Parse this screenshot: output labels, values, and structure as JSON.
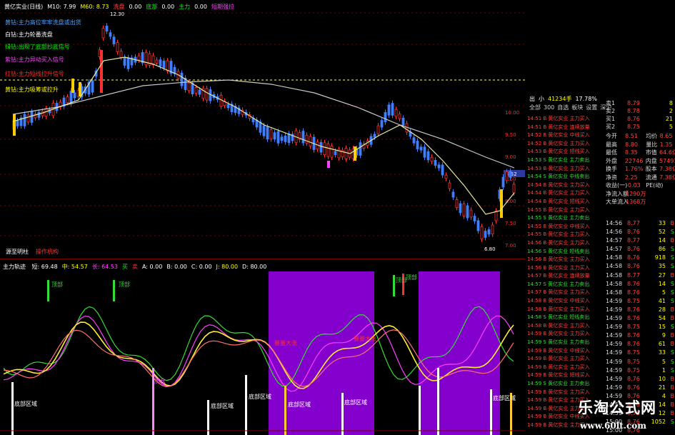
{
  "main": {
    "top_items": [
      {
        "text": "黄亿实业(日线)",
        "color": "#ffffff"
      },
      {
        "text": "M10: 7.99",
        "color": "#ffffff"
      },
      {
        "text": "M60: 8.73",
        "color": "#ffff00"
      },
      {
        "text": "洗盘",
        "color": "#ff4040"
      },
      {
        "text": "0.00",
        "color": "#ffffff"
      },
      {
        "text": "底部",
        "color": "#00ff00"
      },
      {
        "text": "0.00",
        "color": "#ffffff"
      },
      {
        "text": "主力",
        "color": "#00ff00"
      },
      {
        "text": "0.00",
        "color": "#ffffff"
      },
      {
        "text": "短期强拉",
        "color": "#ff40ff"
      }
    ],
    "legend_lines": [
      {
        "text": "黄钻:主力高位牢牢洗盘或出货",
        "color": "#4fa3ff"
      },
      {
        "text": "白钻:主力轮番洗盘",
        "color": "#ffffff"
      },
      {
        "text": "绿钻:出现了底部抄底信号",
        "color": "#00ff00"
      },
      {
        "text": "紫钻:主力异动买入信号",
        "color": "#ff40ff"
      },
      {
        "text": "红钻:主力短线拉升信号",
        "color": "#ff3030"
      },
      {
        "text": "黄钻:主力吸筹或拉升",
        "color": "#ffff00"
      }
    ],
    "high_label": "12.30",
    "low_label": "6.80",
    "bottom_labels": [
      {
        "text": "源至明柱",
        "color": "#ffffff"
      },
      {
        "text": "操作机构",
        "color": "#ff3030"
      }
    ],
    "price_ticks": [
      "10.00",
      "9.50",
      "9.00",
      "8.50",
      "8.00",
      "7.50",
      "7.00"
    ],
    "current_price": "8.52"
  },
  "sub": {
    "title": "主力轨迹",
    "items": [
      {
        "text": "短: 69.48",
        "color": "#ffffff"
      },
      {
        "text": "中: 54.57",
        "color": "#ffff00"
      },
      {
        "text": "长: 64.53",
        "color": "#ff40ff"
      },
      {
        "text": "买",
        "color": "#00ff00"
      },
      {
        "text": "卖",
        "color": "#ff3030"
      },
      {
        "text": "A: 0.00",
        "color": "#ffffff"
      },
      {
        "text": "B: 0.00",
        "color": "#ffffff"
      },
      {
        "text": "C: 0.00",
        "color": "#ffffff"
      },
      {
        "text": "J: 80.00",
        "color": "#ffff00"
      },
      {
        "text": "D: 80.00",
        "color": "#ffffff"
      }
    ],
    "zone_labels": [
      "顶部",
      "顶部",
      "顶部",
      "顶部"
    ],
    "bottom_label": "底部区域",
    "signal_labels": [
      "加仓",
      "暴量大涨",
      "暴量大涨"
    ]
  },
  "right_panel": {
    "header": [
      {
        "text": "出",
        "color": "#ffffff"
      },
      {
        "text": "小",
        "color": "#ffffff"
      },
      {
        "text": "41234手",
        "color": "#ffff00"
      },
      {
        "text": "17.78%",
        "color": "#ffffff"
      }
    ],
    "tabs": [
      "全部",
      "300",
      "自选",
      "板块",
      "设置",
      "深沪"
    ],
    "stock_list": [
      "14:51 B  黄亿实业  主力买入",
      "14:51 B  黄亿实业  连续放量",
      "14:52 B  黄亿实业  中线买入",
      "14:52 B  黄亿实业  主力买入",
      "14:53 B  黄亿实业  短线买入",
      "14:53 S  黄亿实业  主力卖出",
      "14:53 B  黄亿实业  主力买入",
      "14:54 S  黄亿实业  中线卖出",
      "14:54 B  黄亿实业  主力买入",
      "14:54 B  黄亿实业  主力买入",
      "14:54 B  黄亿实业  短线买入",
      "14:55 B  黄亿实业  主力买入",
      "14:55 S  黄亿实业  主力卖出",
      "14:55 B  黄亿实业  中线买入",
      "14:55 B  黄亿实业  主力买入",
      "14:56 B  黄亿实业  主力买入",
      "14:56 S  黄亿实业  短线卖出",
      "14:56 B  黄亿实业  主力买入",
      "14:56 B  黄亿实业  主力买入",
      "14:57 B  黄亿实业  连续放量",
      "14:57 S  黄亿实业  主力卖出",
      "14:57 B  黄亿实业  主力买入",
      "14:58 B  黄亿实业  中线买入",
      "14:58 B  黄亿实业  主力买入",
      "14:58 S  黄亿实业  短线卖出",
      "14:58 B  黄亿实业  主力买入",
      "14:59 B  黄亿实业  主力买入",
      "14:59 S  黄亿实业  主力卖出",
      "14:59 B  黄亿实业  中线买入",
      "14:59 B  黄亿实业  主力买入",
      "14:59 B  黄亿实业  主力买入",
      "14:59 B  黄亿实业  短线买入",
      "14:59 S  黄亿实业  主力卖出",
      "14:59 B  黄亿实业  主力买入",
      "14:59 B  黄亿实业  主力买入",
      "14:59 B  黄亿实业  主力买入",
      "14:59 B  黄亿实业  中线买入",
      "14:59 B  黄亿实业  主力买入"
    ],
    "order_rows": [
      {
        "label": "卖1",
        "price": "8.79",
        "vol": "8"
      },
      {
        "label": "卖2",
        "price": "8.78",
        "vol": "2"
      },
      {
        "label": "买1",
        "price": "8.76",
        "vol": "21"
      },
      {
        "label": "买2",
        "price": "8.75",
        "vol": "5"
      }
    ],
    "stats": [
      {
        "k": "今开",
        "v": "8.51",
        "k2": "均价",
        "v2": "8.65"
      },
      {
        "k": "最高",
        "v": "8.80",
        "k2": "量比",
        "v2": "1.35"
      },
      {
        "k": "最低",
        "v": "8.35",
        "k2": "市值",
        "v2": "64.6亿"
      },
      {
        "k": "外盘",
        "v": "22746",
        "k2": "内盘",
        "v2": "57491"
      },
      {
        "k": "换手",
        "v": "1.76%",
        "k2": "股本",
        "v2": "7.38亿"
      },
      {
        "k": "净资",
        "v": "2.25",
        "k2": "流通",
        "v2": "7.38亿"
      },
      {
        "k": "收益(一)",
        "v": "-0.03",
        "k2": "PE(动)",
        "v2": ""
      },
      {
        "k": "净流入额",
        "v": "1290万",
        "k2": "",
        "v2": ""
      },
      {
        "k": "大单流入",
        "v": "1368万",
        "k2": "",
        "v2": ""
      }
    ],
    "trades": [
      {
        "t": "14:56",
        "p": "8.77",
        "v": "33",
        "d": "B"
      },
      {
        "t": "14:56",
        "p": "8.76",
        "v": "52",
        "d": "S"
      },
      {
        "t": "14:57",
        "p": "8.77",
        "v": "14",
        "d": "B"
      },
      {
        "t": "14:57",
        "p": "8.76",
        "v": "86",
        "d": "S"
      },
      {
        "t": "14:58",
        "p": "8.76",
        "v": "918",
        "d": "S"
      },
      {
        "t": "14:58",
        "p": "8.76",
        "v": "35",
        "d": "S"
      },
      {
        "t": "14:58",
        "p": "8.77",
        "v": "27",
        "d": "B"
      },
      {
        "t": "14:58",
        "p": "8.76",
        "v": "14",
        "d": "S"
      },
      {
        "t": "14:58",
        "p": "8.76",
        "v": "5",
        "d": "S"
      },
      {
        "t": "14:59",
        "p": "8.75",
        "v": "41",
        "d": "S"
      },
      {
        "t": "14:59",
        "p": "8.76",
        "v": "28",
        "d": "B"
      },
      {
        "t": "14:59",
        "p": "8.76",
        "v": "54",
        "d": "B"
      },
      {
        "t": "14:59",
        "p": "8.75",
        "v": "15",
        "d": "S"
      },
      {
        "t": "14:59",
        "p": "8.76",
        "v": "9",
        "d": "B"
      },
      {
        "t": "14:59",
        "p": "8.76",
        "v": "61",
        "d": "B"
      },
      {
        "t": "14:59",
        "p": "8.75",
        "v": "33",
        "d": "S"
      },
      {
        "t": "14:59",
        "p": "8.75",
        "v": "5",
        "d": "S"
      },
      {
        "t": "14:59",
        "p": "8.75",
        "v": "1",
        "d": "S"
      },
      {
        "t": "14:59",
        "p": "8.76",
        "v": "10",
        "d": "B"
      },
      {
        "t": "14:59",
        "p": "8.76",
        "v": "21",
        "d": "B"
      },
      {
        "t": "14:59",
        "p": "8.76",
        "v": "4",
        "d": "B"
      },
      {
        "t": "14:59",
        "p": "8.76",
        "v": "14",
        "d": "B"
      },
      {
        "t": "14:59",
        "p": "8.76",
        "v": "12",
        "d": "B"
      },
      {
        "t": "15:00",
        "p": "8.76",
        "v": "1052",
        "d": "S"
      },
      {
        "t": "15:00",
        "p": "8.76",
        "v": "",
        "d": ""
      }
    ]
  },
  "watermark": {
    "title": "乐淘公式网",
    "url": "www.60lt.com"
  },
  "colors": {
    "up": "#ff3030",
    "down": "#4f8fff",
    "ma10": "#e8e8a0",
    "ma60": "#c8c8c8",
    "purple_zone": "#8a00d8"
  }
}
